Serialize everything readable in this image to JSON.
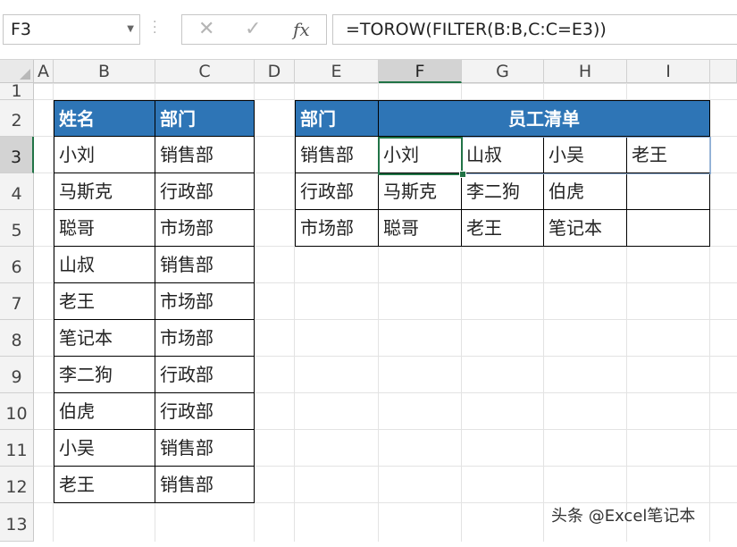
{
  "formula_bar": {
    "name_box": "F3",
    "cancel_icon": "close-icon",
    "enter_icon": "check-icon",
    "fx_label": "fx",
    "formula": "=TOROW(FILTER(B:B,C:C=E3))"
  },
  "columns": [
    "A",
    "B",
    "C",
    "D",
    "E",
    "F",
    "G",
    "H",
    "I"
  ],
  "rows": [
    "1",
    "2",
    "3",
    "4",
    "5",
    "6",
    "7",
    "8",
    "9",
    "10",
    "11",
    "12",
    "13"
  ],
  "selected_cell": "F3",
  "source_table": {
    "headers": [
      "姓名",
      "部门"
    ],
    "rows": [
      [
        "小刘",
        "销售部"
      ],
      [
        "马斯克",
        "行政部"
      ],
      [
        "聪哥",
        "市场部"
      ],
      [
        "山叔",
        "销售部"
      ],
      [
        "老王",
        "市场部"
      ],
      [
        "笔记本",
        "市场部"
      ],
      [
        "李二狗",
        "行政部"
      ],
      [
        "伯虎",
        "行政部"
      ],
      [
        "小吴",
        "销售部"
      ],
      [
        "老王",
        "销售部"
      ]
    ]
  },
  "result_table": {
    "header_dept": "部门",
    "header_list": "员工清单",
    "rows": [
      {
        "dept": "销售部",
        "names": [
          "小刘",
          "山叔",
          "小吴",
          "老王"
        ]
      },
      {
        "dept": "行政部",
        "names": [
          "马斯克",
          "李二狗",
          "伯虎",
          ""
        ]
      },
      {
        "dept": "市场部",
        "names": [
          "聪哥",
          "老王",
          "笔记本",
          ""
        ]
      }
    ]
  },
  "colors": {
    "header_fill": "#2e75b6",
    "selection": "#217346"
  },
  "watermark": "头条 @Excel笔记本"
}
